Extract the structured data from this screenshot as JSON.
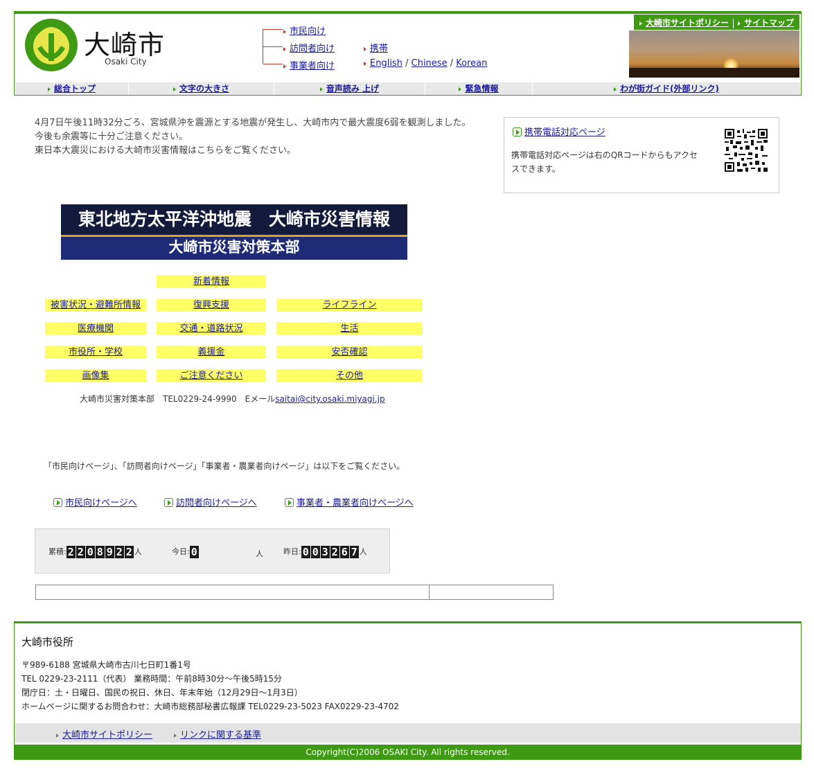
{
  "header": {
    "logo_name": "大崎市",
    "logo_sub": "Osaki City",
    "audience_links": [
      "市民向け",
      "訪問者向け",
      "事業者向け"
    ],
    "mobile_link": "携帯",
    "lang_links": [
      "English",
      "Chinese",
      "Korean"
    ],
    "lang_sep": "/",
    "top_links": [
      "大崎市サイトポリシー",
      "サイトマップ"
    ],
    "nav": [
      "総合トップ",
      "文字の大きさ",
      "音声読み 上げ",
      "緊急情報",
      "わが街ガイド(外部リンク)"
    ]
  },
  "notice": {
    "lines": [
      "4月7日午後11時32分ごろ、宮城県沖を震源とする地震が発生し、大崎市内で最大震度6弱を観測しました。",
      "今後も余震等に十分ご注意ください。",
      "東日本大震災における大崎市災害情報はこちらをご覧ください。"
    ]
  },
  "mobile_box": {
    "link": "携帯電話対応ページ",
    "text_line1": "携帯電話対応ページは右のQRコードからもアクセ",
    "text_line2": "スできます。"
  },
  "banner": {
    "top": "東北地方太平洋沖地震　大崎市災害情報",
    "bottom": "大崎市災害対策本部"
  },
  "disaster_links": {
    "new": "新着情報",
    "col1": [
      "被害状況・避難所情報",
      "医療機関",
      "市役所・学校",
      "画像集"
    ],
    "col2": [
      "復興支援",
      "交通・道路状況",
      "義援金",
      "ご注意ください"
    ],
    "col3": [
      "ライフライン",
      "生活",
      "安否確認",
      "その他"
    ]
  },
  "contact": {
    "text": "大崎市災害対策本部　TEL0229-24-9990　Eメール",
    "email": "saitai@city.osaki.miyagi.jp"
  },
  "guide": {
    "text": "「市民向けページ」、「訪問者向けページ」「事業者・農業者向けページ」は以下をご覧ください。",
    "links": [
      "市民向けページへ",
      "訪問者向けページへ",
      "事業者・農業者向けページへ"
    ]
  },
  "counter": {
    "total_label": "累積:",
    "total_digits": [
      "2",
      "2",
      "0",
      "8",
      "9",
      "2",
      "2"
    ],
    "today_label": "今日:",
    "today_digits": [
      "0"
    ],
    "yesterday_label": "昨日:",
    "yesterday_digits": [
      "0",
      "0",
      "3",
      "2",
      "6",
      "7"
    ],
    "unit": "人"
  },
  "footer": {
    "title": "大崎市役所",
    "address_lines": [
      "〒989-6188 宮城県大崎市古川七日町1番1号",
      "TEL 0229-23-2111（代表）  業務時間：午前8時30分〜午後5時15分",
      "閉庁日：土・日曜日、国民の祝日、休日、年末年始（12月29日〜1月3日）",
      "ホームページに関するお問合わせ：大崎市総務部秘書広報課  TEL0229-23-5023 FAX0229-23-4702"
    ],
    "links": [
      "大崎市サイトポリシー",
      "リンクに関する基準"
    ],
    "copyright": "Copyright(C)2006 OSAKI City. All rights reserved."
  },
  "colors": {
    "brand_green": "#3d9a12",
    "banner_navy": "#1e2c78",
    "highlight_yellow": "#ffff66"
  }
}
